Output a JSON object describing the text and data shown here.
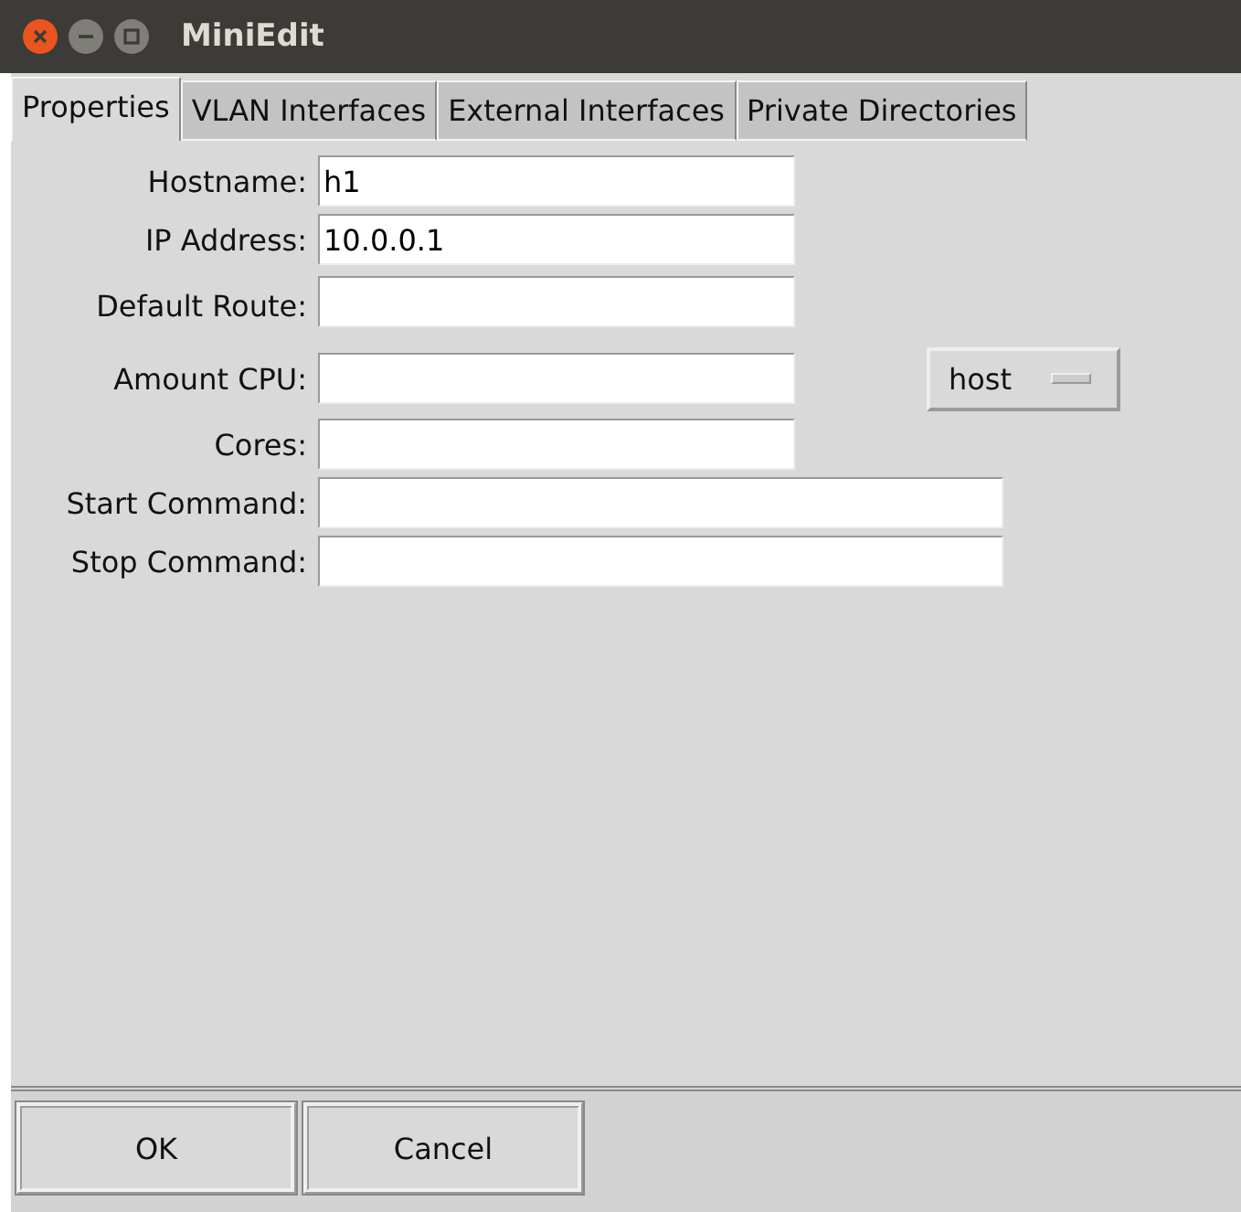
{
  "window": {
    "title": "MiniEdit"
  },
  "tabs": [
    {
      "label": "Properties",
      "selected": true
    },
    {
      "label": "VLAN Interfaces",
      "selected": false
    },
    {
      "label": "External Interfaces",
      "selected": false
    },
    {
      "label": "Private Directories",
      "selected": false
    }
  ],
  "fields": [
    {
      "kind": "entry",
      "label": "Hostname:",
      "value": "h1"
    },
    {
      "kind": "entry",
      "label": "IP Address:",
      "value": "10.0.0.1"
    },
    {
      "kind": "entry",
      "label": "Default Route:"
    },
    {
      "kind": "menu",
      "label": "Amount CPU:",
      "menu": "host"
    },
    {
      "kind": "entry",
      "label": "Cores:"
    },
    {
      "kind": "command",
      "label": "Start Command:"
    },
    {
      "kind": "command",
      "label": "Stop Command:"
    }
  ],
  "buttons": [
    "OK",
    "Cancel"
  ]
}
